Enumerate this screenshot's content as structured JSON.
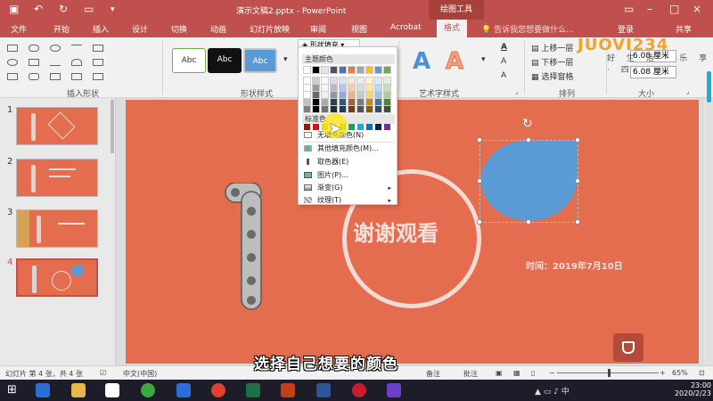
{
  "window": {
    "title": "演示文稿2.pptx - PowerPoint",
    "context_tab": "绘图工具"
  },
  "tabs": [
    "文件",
    "开始",
    "插入",
    "设计",
    "切换",
    "动画",
    "幻灯片放映",
    "审阅",
    "视图",
    "Acrobat",
    "格式"
  ],
  "tell_me": "告诉我您想要做什么...",
  "account": {
    "login": "登录",
    "share": "共享"
  },
  "ribbon": {
    "insert_shapes": "插入形状",
    "shape_styles": "形状样式",
    "style_label": "Abc",
    "art_styles": "艺术字样式",
    "art_glyph": "A",
    "arrange": "排列",
    "size": "大小",
    "bring_forward": "上移一层",
    "send_backward": "下移一层",
    "selection_pane": "选择窗格",
    "height": "6.08 厘米",
    "width": "6.08 厘米",
    "fill_button": "形状填充"
  },
  "logo": {
    "text": "JUOVI234",
    "sub": "好 生 活 · 乐 享 · 四"
  },
  "fill_menu": {
    "theme_colors": "主题颜色",
    "standard_colors": "标准色",
    "no_fill": "无填充颜色(N)",
    "more_colors": "其他填充颜色(M)...",
    "eyedropper": "取色器(E)",
    "picture": "图片(P)...",
    "gradient": "渐变(G)",
    "texture": "纹理(T)"
  },
  "colors": {
    "theme_top": [
      "#ffffff",
      "#000000",
      "#e7e6e6",
      "#44546a",
      "#4472c4",
      "#ed7d31",
      "#a5a5a5",
      "#ffc000",
      "#5b9bd5",
      "#70ad47"
    ],
    "standard": [
      "#c00000",
      "#ff0000",
      "#ffc000",
      "#ffff00",
      "#92d050",
      "#00b050",
      "#00b0f0",
      "#0070c0",
      "#002060",
      "#7030a0"
    ]
  },
  "thumbnails": [
    {
      "num": "1"
    },
    {
      "num": "2"
    },
    {
      "num": "3"
    },
    {
      "num": "4"
    }
  ],
  "slide": {
    "thanks": "谢谢观看",
    "date": "时间：2019年7月10日"
  },
  "statusbar": {
    "slide_info": "幻灯片 第 4 张，共 4 张",
    "language": "中文(中国)",
    "notes": "备注",
    "comments": "批注",
    "zoom": "65%"
  },
  "subtitle": "选择自己想要的颜色",
  "clock": {
    "time": "23:00",
    "date": "2020/2/23"
  }
}
